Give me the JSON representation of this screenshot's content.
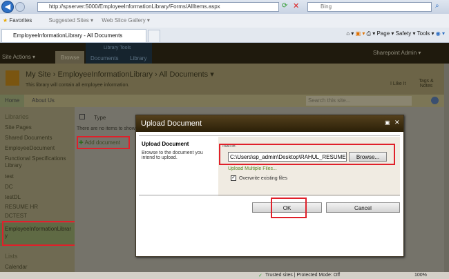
{
  "browser": {
    "url": "http://spserver:5000/EmployeeInformationLibrary/Forms/AllItems.aspx",
    "search_placeholder": "Bing",
    "favorites": "Favorites",
    "suggested_sites": "Suggested Sites ▾",
    "web_slice_gallery": "Web Slice Gallery ▾",
    "tab_title": "EmployeeInformationLibrary - All Documents",
    "page_menu": "Page ▾",
    "safety_menu": "Safety ▾",
    "tools_menu": "Tools ▾"
  },
  "ribbon": {
    "site_actions": "Site Actions ▾",
    "browse": "Browse",
    "library_tools": "Library Tools",
    "documents": "Documents",
    "library": "Library",
    "user": "Sharepoint Admin ▾"
  },
  "title_area": {
    "crumb1": "My Site",
    "crumb2": "EmployeeInformationLibrary",
    "crumb3": "All Documents ▾",
    "sep": "›",
    "description": "This library will contain all employee information.",
    "i_like_it": "I Like It",
    "tags_notes": "Tags & Notes"
  },
  "nav": {
    "home": "Home",
    "about": "About Us",
    "search_placeholder": "Search this site..."
  },
  "leftnav": {
    "libraries": "Libraries",
    "items": [
      "Site Pages",
      "Shared Documents",
      "EmployeeDocument",
      "Functional Specifications Library",
      "test",
      "DC",
      "testDL",
      "RESUME HR",
      "DCTEST",
      "EmployeeInformationLibrary"
    ],
    "lists": "Lists",
    "calendar": "Calendar"
  },
  "main": {
    "type_header": "Type",
    "empty": "There are no items to show",
    "add_document": "Add document"
  },
  "dialog": {
    "title": "Upload Document",
    "section_title": "Upload Document",
    "section_desc": "Browse to the document you intend to upload.",
    "name_label": "Name:",
    "file_value": "C:\\Users\\sp_admin\\Desktop\\RAHUL_RESUME",
    "browse": "Browse...",
    "upload_multiple": "Upload Multiple Files...",
    "overwrite": "Overwrite existing files",
    "overwrite_checked": true,
    "ok": "OK",
    "cancel": "Cancel"
  },
  "status": {
    "zone": "Trusted sites | Protected Mode: Off",
    "zoom": "100%"
  }
}
